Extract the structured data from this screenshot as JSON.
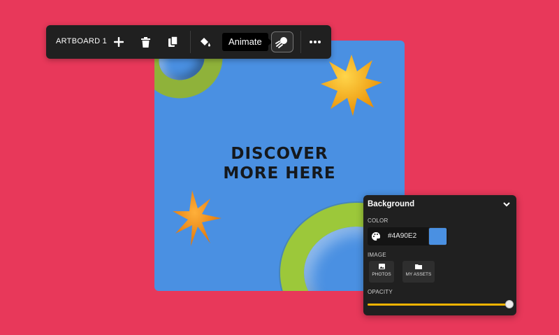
{
  "canvas": {
    "headline_line1": "DISCOVER",
    "headline_line2": "MORE HERE",
    "background": "#4a90e2"
  },
  "toolbar": {
    "title": "ARTBOARD 1",
    "buttons": [
      {
        "name": "add",
        "icon": "plus-icon"
      },
      {
        "name": "delete",
        "icon": "trash-icon"
      },
      {
        "name": "duplicate",
        "icon": "copy-icon"
      },
      {
        "name": "fill",
        "icon": "paint-bucket-icon"
      },
      {
        "name": "animate",
        "icon": "animate-icon"
      },
      {
        "name": "more",
        "icon": "more-icon"
      }
    ],
    "tooltip": "Animate"
  },
  "panel": {
    "title": "Background",
    "color_label": "COLOR",
    "color_value": "#4A90E2",
    "swatch_color": "#4a90e2",
    "image_label": "IMAGE",
    "image_buttons": [
      "PHOTOS",
      "MY ASSETS"
    ],
    "opacity_label": "OPACITY",
    "opacity_value": 1.0
  },
  "colors": {
    "page_bg": "#e8385a",
    "toolbar_bg": "#202020",
    "slider": "#f5b400"
  }
}
